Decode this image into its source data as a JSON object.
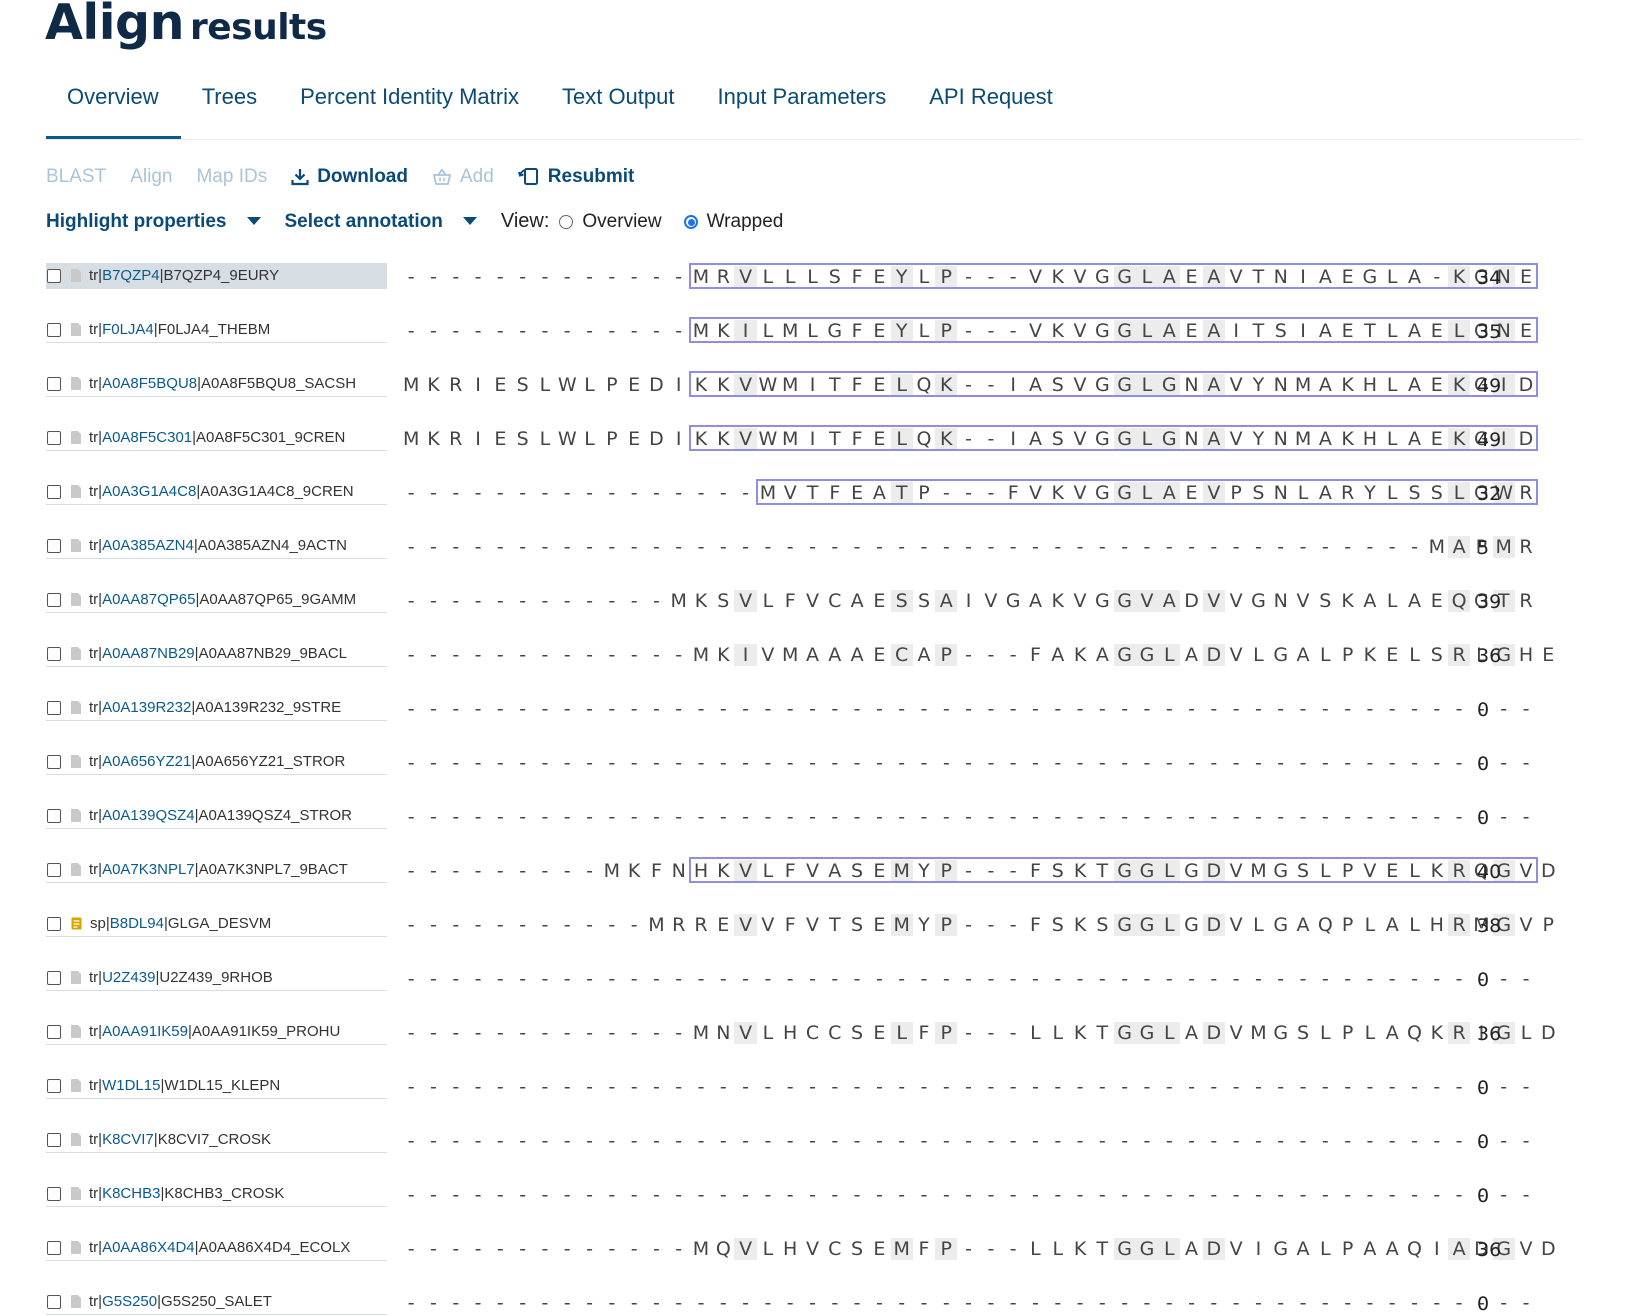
{
  "page": {
    "title": "Align",
    "title_suffix": "results"
  },
  "tabs": [
    {
      "label": "Overview",
      "active": true
    },
    {
      "label": "Trees",
      "active": false
    },
    {
      "label": "Percent Identity Matrix",
      "active": false
    },
    {
      "label": "Text Output",
      "active": false
    },
    {
      "label": "Input Parameters",
      "active": false
    },
    {
      "label": "API Request",
      "active": false
    }
  ],
  "toolbar": {
    "blast": "BLAST",
    "align": "Align",
    "map_ids": "Map IDs",
    "download": "Download",
    "add": "Add",
    "resubmit": "Resubmit"
  },
  "controls": {
    "highlight": "Highlight properties",
    "annotation": "Select annotation",
    "view_label": "View:",
    "view_overview": "Overview",
    "view_wrapped": "Wrapped",
    "view_selected": "Wrapped"
  },
  "colors": {
    "brand": "#0e2a47",
    "link": "#0b5a8c",
    "feature_box": "#8f8ee6",
    "highlight_cell": "#ececec"
  },
  "entries": [
    {
      "db": "tr",
      "accession": "B7QZP4",
      "entry_name": "B7QZP4_9EURY",
      "sequence": "-------------MRVLLLSFEYLP---VKVGGLAEAVTNIAEGLA-KGNE",
      "length": "34",
      "selected": true
    },
    {
      "db": "tr",
      "accession": "F0LJA4",
      "entry_name": "F0LJA4_THEBM",
      "sequence": "-------------MKILMLGFEYLP---VKVGGLAEAITSIAETLAELGNE",
      "length": "35"
    },
    {
      "db": "tr",
      "accession": "A0A8F5BQU8",
      "entry_name": "A0A8F5BQU8_SACSH",
      "sequence": "MKRIESLWLPEDIKKVWMITFELQK--IASVGGLGNAVYNMAKHLAEKGID",
      "length": "49"
    },
    {
      "db": "tr",
      "accession": "A0A8F5C301",
      "entry_name": "A0A8F5C301_9CREN",
      "sequence": "MKRIESLWLPEDIKKVWMITFELQK--IASVGGLGNAVYNMAKHLAEKGID",
      "length": "49"
    },
    {
      "db": "tr",
      "accession": "A0A3G1A4C8",
      "entry_name": "A0A3G1A4C8_9CREN",
      "sequence": "----------------MVTFEATP---FVKVGGLAEVPSNLARYLSSLGWR",
      "length": "32"
    },
    {
      "db": "tr",
      "accession": "A0A385AZN4",
      "entry_name": "A0A385AZN4_9ACTN",
      "sequence": "----------------------------------------------MAPMR",
      "length": "5"
    },
    {
      "db": "tr",
      "accession": "A0AA87QP65",
      "entry_name": "A0AA87QP65_9GAMM",
      "sequence": "------------MKSVLFVCAESSAIVGAKVGGVADVVGNVSKALAEQGTR",
      "length": "39"
    },
    {
      "db": "tr",
      "accession": "A0AA87NB29",
      "entry_name": "A0AA87NB29_9BACL",
      "sequence": "-------------MKIVMAAAECAP---FAKAGGLADVLGALPKELSRLGHE",
      "length": "36"
    },
    {
      "db": "tr",
      "accession": "A0A139R232",
      "entry_name": "A0A139R232_9STRE",
      "sequence": "---------------------------------------------------",
      "length": "0"
    },
    {
      "db": "tr",
      "accession": "A0A656YZ21",
      "entry_name": "A0A656YZ21_STROR",
      "sequence": "---------------------------------------------------",
      "length": "0"
    },
    {
      "db": "tr",
      "accession": "A0A139QSZ4",
      "entry_name": "A0A139QSZ4_STROR",
      "sequence": "---------------------------------------------------",
      "length": "0"
    },
    {
      "db": "tr",
      "accession": "A0A7K3NPL7",
      "entry_name": "A0A7K3NPL7_9BACT",
      "sequence": "---------MKFNHKVLFVASEMYP---FSKTGGLGDVMGSLPVELKRQGVD",
      "length": "40"
    },
    {
      "db": "sp",
      "accession": "B8DL94",
      "entry_name": "GLGA_DESVM",
      "sequence": "-----------MRREVVFVTSEMYP---FSKSGGLGDVLGAQPLALHRMGVP",
      "length": "38"
    },
    {
      "db": "tr",
      "accession": "U2Z439",
      "entry_name": "U2Z439_9RHOB",
      "sequence": "---------------------------------------------------",
      "length": "0"
    },
    {
      "db": "tr",
      "accession": "A0AA91IK59",
      "entry_name": "A0AA91IK59_PROHU",
      "sequence": "-------------MNVLHCCSELFP---LLKTGGLADVMGSLPLAQKRIGLD",
      "length": "36"
    },
    {
      "db": "tr",
      "accession": "W1DL15",
      "entry_name": "W1DL15_KLEPN",
      "sequence": "---------------------------------------------------",
      "length": "0"
    },
    {
      "db": "tr",
      "accession": "K8CVI7",
      "entry_name": "K8CVI7_CROSK",
      "sequence": "---------------------------------------------------",
      "length": "0"
    },
    {
      "db": "tr",
      "accession": "K8CHB3",
      "entry_name": "K8CHB3_CROSK",
      "sequence": "---------------------------------------------------",
      "length": "0"
    },
    {
      "db": "tr",
      "accession": "A0AA86X4D4",
      "entry_name": "A0AA86X4D4_ECOLX",
      "sequence": "-------------MQVLHVCSEMFP---LLKTGGLADVIGALPAAQIADGVD",
      "length": "36"
    },
    {
      "db": "tr",
      "accession": "G5S250",
      "entry_name": "G5S250_SALET",
      "sequence": "---------------------------------------------------",
      "length": "0"
    }
  ]
}
